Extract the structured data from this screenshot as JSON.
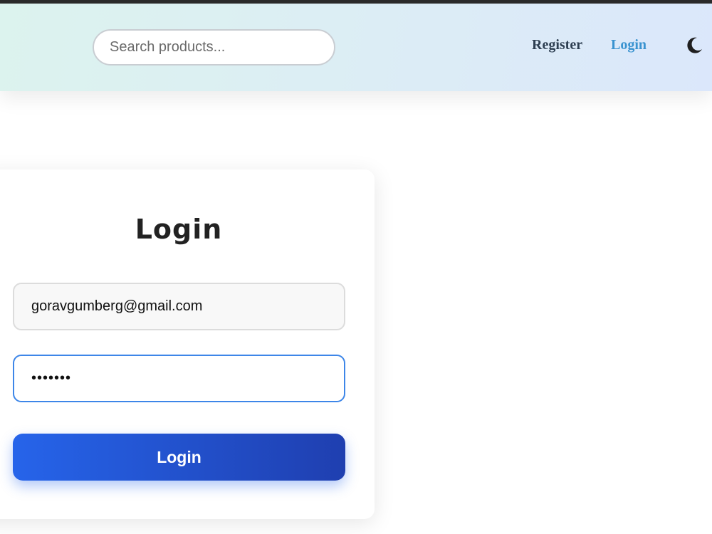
{
  "header": {
    "search": {
      "placeholder": "Search products...",
      "value": ""
    },
    "nav": {
      "register_label": "Register",
      "login_label": "Login"
    },
    "theme_toggle_icon": "moon-icon"
  },
  "login_form": {
    "title": "Login",
    "email": {
      "value": "goravgumberg@gmail.com"
    },
    "password": {
      "value": "•••••••"
    },
    "submit_label": "Login"
  },
  "colors": {
    "accent": "#2664ea",
    "nav_active": "#3a93d0",
    "focus_border": "#3d86e8"
  }
}
